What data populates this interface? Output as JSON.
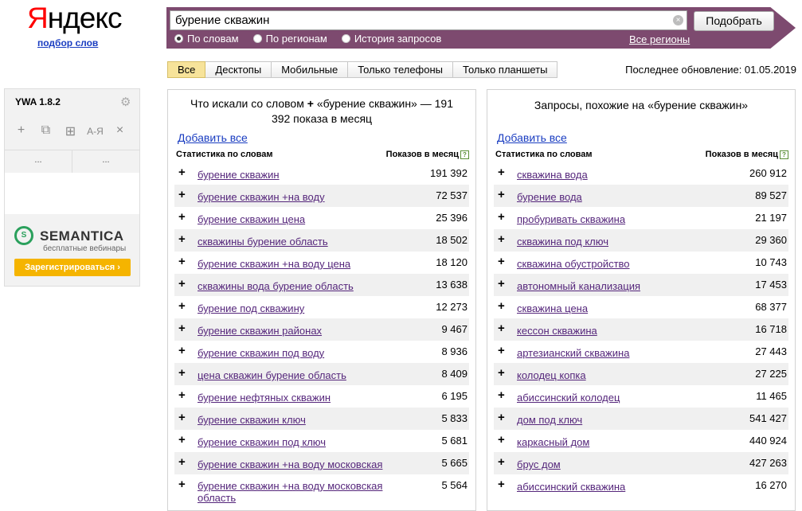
{
  "logo": {
    "first": "Я",
    "rest": "ндекс",
    "sub": "подбор слов"
  },
  "search": {
    "value": "бурение скважин",
    "button": "Подобрать",
    "clear": "×"
  },
  "radios": [
    "По словам",
    "По регионам",
    "История запросов"
  ],
  "regions_link": "Все регионы",
  "tabs": [
    "Все",
    "Десктопы",
    "Мобильные",
    "Только телефоны",
    "Только планшеты"
  ],
  "last_update": "Последнее обновление: 01.05.2019",
  "ywa": {
    "title": "YWA 1.8.2",
    "cells": [
      "...",
      "..."
    ],
    "tools": [
      "+",
      "⧉",
      "⊞",
      "А-Я",
      "×"
    ],
    "semantica": "SEMANTICA",
    "semantica_sub": "бесплатные вебинары",
    "register": "Зарегистрироваться ›"
  },
  "left": {
    "title_pre": "Что искали со словом",
    "title_plus": "+",
    "title_post": "«бурение скважин» — 191 392 показа в месяц",
    "add_all": "Добавить все",
    "col1": "Статистика по словам",
    "col2": "Показов в месяц",
    "rows": [
      {
        "kw": "бурение скважин",
        "n": "191 392"
      },
      {
        "kw": "бурение скважин +на воду",
        "n": "72 537"
      },
      {
        "kw": "бурение скважин цена",
        "n": "25 396"
      },
      {
        "kw": "скважины бурение область",
        "n": "18 502"
      },
      {
        "kw": "бурение скважин +на воду цена",
        "n": "18 120"
      },
      {
        "kw": "скважины вода бурение область",
        "n": "13 638"
      },
      {
        "kw": "бурение под скважину",
        "n": "12 273"
      },
      {
        "kw": "бурение скважин районах",
        "n": "9 467"
      },
      {
        "kw": "бурение скважин под воду",
        "n": "8 936"
      },
      {
        "kw": "цена скважин бурение область",
        "n": "8 409"
      },
      {
        "kw": "бурение нефтяных скважин",
        "n": "6 195"
      },
      {
        "kw": "бурение скважин ключ",
        "n": "5 833"
      },
      {
        "kw": "бурение скважин под ключ",
        "n": "5 681"
      },
      {
        "kw": "бурение скважин +на воду московская",
        "n": "5 665"
      },
      {
        "kw": "бурение скважин +на воду московская область",
        "n": "5 564"
      }
    ]
  },
  "right": {
    "title": "Запросы, похожие на «бурение скважин»",
    "add_all": "Добавить все",
    "col1": "Статистика по словам",
    "col2": "Показов в месяц",
    "rows": [
      {
        "kw": "скважина вода",
        "n": "260 912"
      },
      {
        "kw": "бурение вода",
        "n": "89 527"
      },
      {
        "kw": "пробуривать скважина",
        "n": "21 197"
      },
      {
        "kw": "скважина под ключ",
        "n": "29 360"
      },
      {
        "kw": "скважина обустройство",
        "n": "10 743"
      },
      {
        "kw": "автономный канализация",
        "n": "17 453"
      },
      {
        "kw": "скважина цена",
        "n": "68 377"
      },
      {
        "kw": "кессон скважина",
        "n": "16 718"
      },
      {
        "kw": "артезианский скважина",
        "n": "27 443"
      },
      {
        "kw": "колодец копка",
        "n": "27 225"
      },
      {
        "kw": "абиссинский колодец",
        "n": "11 465"
      },
      {
        "kw": "дом под ключ",
        "n": "541 427"
      },
      {
        "kw": "каркасный дом",
        "n": "440 924"
      },
      {
        "kw": "брус дом",
        "n": "427 263"
      },
      {
        "kw": "абиссинский скважина",
        "n": "16 270"
      }
    ]
  },
  "colors": {
    "band": "#7d4a6f",
    "link": "#1a3dc1",
    "visited": "#55267b",
    "tab_active": "#f7e39a",
    "register": "#f5b400"
  }
}
